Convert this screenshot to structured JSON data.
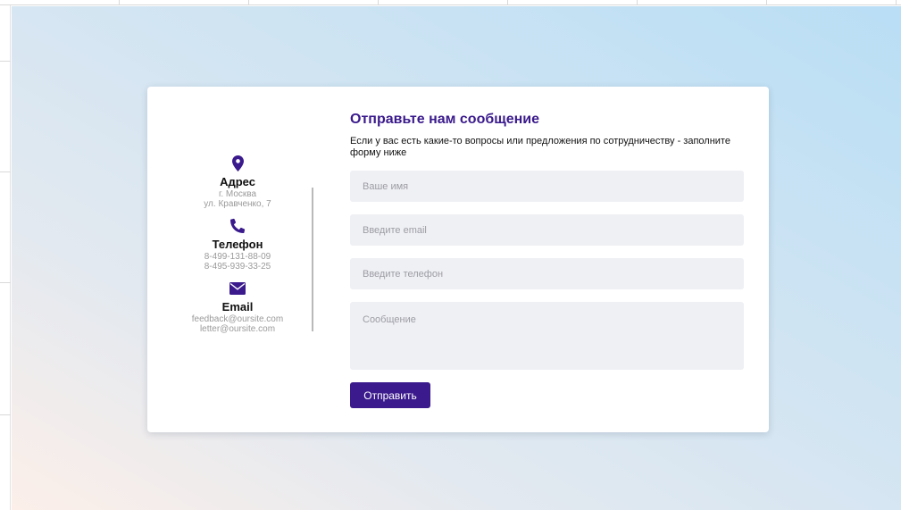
{
  "contacts": {
    "address": {
      "icon": "map-marker-icon",
      "title": "Адрес",
      "lines": [
        "г. Москва",
        "ул. Кравченко, 7"
      ]
    },
    "phone": {
      "icon": "phone-icon",
      "title": "Телефон",
      "lines": [
        "8-499-131-88-09",
        "8-495-939-33-25"
      ]
    },
    "email": {
      "icon": "envelope-icon",
      "title": "Email",
      "lines": [
        "feedback@oursite.com",
        "letter@oursite.com"
      ]
    }
  },
  "form": {
    "title": "Отправьте нам сообщение",
    "subtitle": "Если у вас есть какие-то вопросы или предложения по сотрудничеству - заполните форму ниже",
    "name_placeholder": "Ваше имя",
    "email_placeholder": "Введите email",
    "phone_placeholder": "Введите телефон",
    "message_placeholder": "Сообщение",
    "submit_label": "Отправить"
  },
  "colors": {
    "accent": "#3a1a8c",
    "field_bg": "#eff0f4",
    "muted_text": "#9a9a9a"
  }
}
